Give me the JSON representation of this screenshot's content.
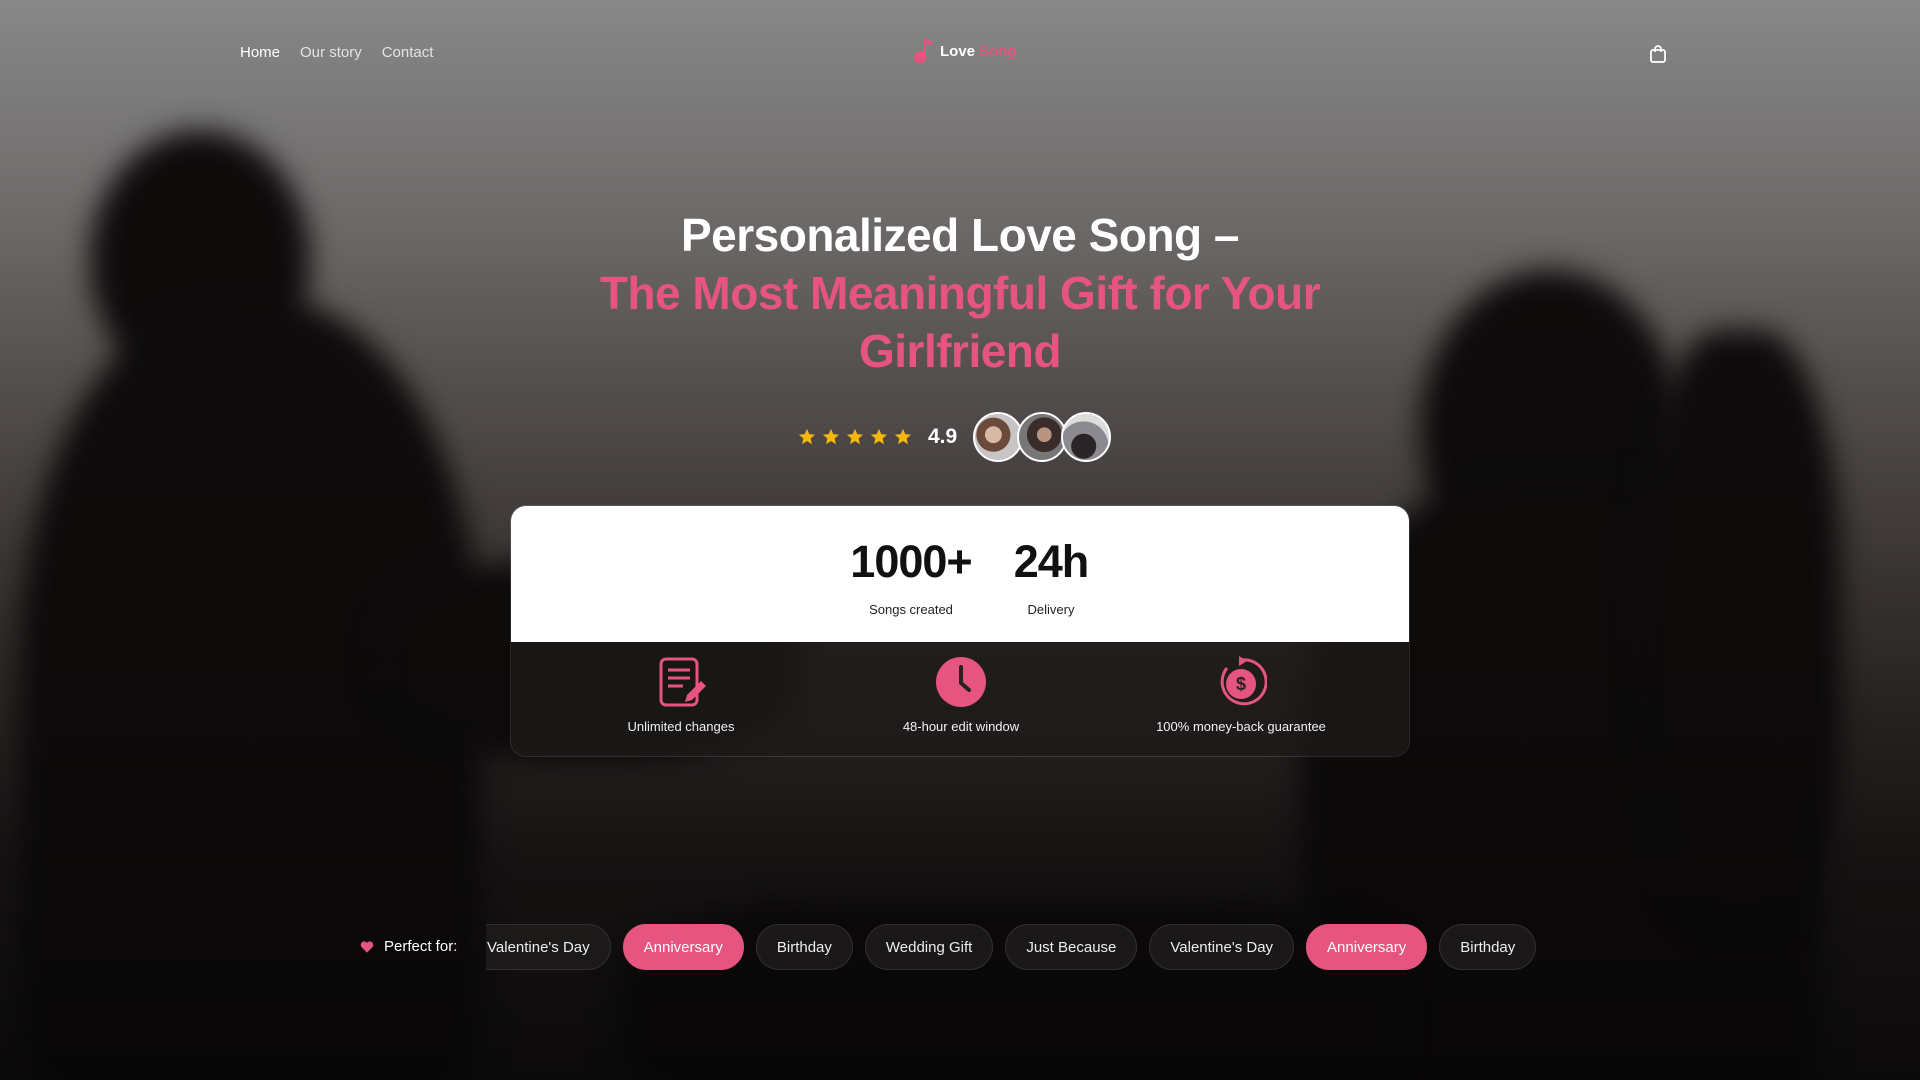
{
  "nav": {
    "links": [
      {
        "label": "Home",
        "active": true
      },
      {
        "label": "Our story",
        "active": false
      },
      {
        "label": "Contact",
        "active": false
      }
    ],
    "logo": {
      "word1": "Love",
      "word2": "Song",
      "icon": "music-note-icon"
    },
    "cart_icon": "shopping-bag-icon"
  },
  "hero": {
    "title_line1": "Personalized Love Song –",
    "title_line2": "The Most Meaningful Gift for Your Girlfriend",
    "rating": {
      "stars": 5,
      "value": "4.9",
      "star_color": "#f5b80b"
    },
    "avatars": [
      "avatar-couple-1",
      "avatar-couple-2",
      "avatar-couple-3"
    ]
  },
  "stats": [
    {
      "value": "1000+",
      "label": "Songs created"
    },
    {
      "value": "24h",
      "label": "Delivery"
    }
  ],
  "features": [
    {
      "icon": "document-edit-icon",
      "label": "Unlimited changes"
    },
    {
      "icon": "clock-icon",
      "label": "48-hour edit window"
    },
    {
      "icon": "money-back-icon",
      "label": "100% money-back guarantee"
    }
  ],
  "perfect_for": {
    "label": "Perfect for:",
    "icon": "heart-icon",
    "chips": [
      {
        "label": "Valentine's Day",
        "highlighted": false
      },
      {
        "label": "Anniversary",
        "highlighted": true
      },
      {
        "label": "Birthday",
        "highlighted": false
      },
      {
        "label": "Wedding Gift",
        "highlighted": false
      },
      {
        "label": "Just Because",
        "highlighted": false
      },
      {
        "label": "Valentine's Day",
        "highlighted": false
      },
      {
        "label": "Anniversary",
        "highlighted": true
      },
      {
        "label": "Birthday",
        "highlighted": false
      }
    ]
  },
  "colors": {
    "accent": "#e5557f",
    "star": "#f5b80b",
    "card_bg": "#ffffff"
  }
}
